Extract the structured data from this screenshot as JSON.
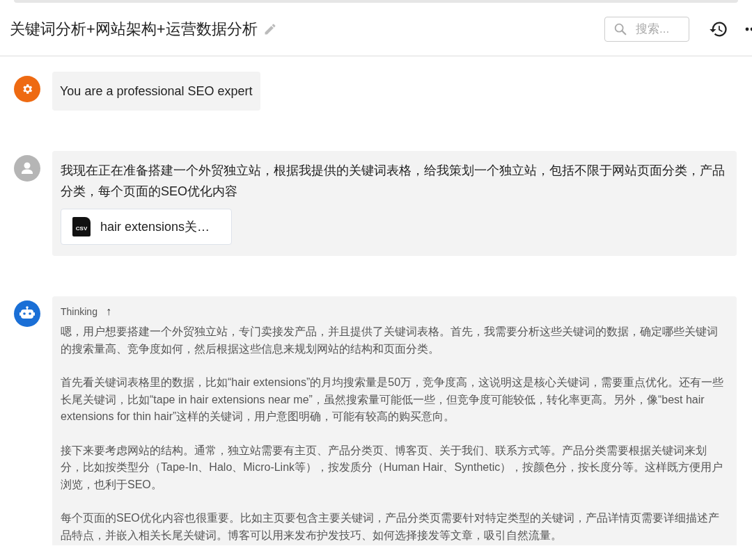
{
  "header": {
    "title": "关键词分析+网站架构+运营数据分析",
    "search": {
      "placeholder": "搜索..."
    }
  },
  "messages": [
    {
      "kind": "system",
      "text": "You are a professional SEO expert"
    },
    {
      "kind": "user",
      "text": "我现在正在准备搭建一个外贸独立站，根据我提供的关键词表格，给我策划一个独立站，包括不限于网站页面分类，产品分类，每个页面的SEO优化内容",
      "attachment": {
        "icon_label": "CSV",
        "name": "hair extensions关…"
      }
    },
    {
      "kind": "assistant",
      "thinking": {
        "label": "Thinking",
        "toggle": "↑",
        "expanded": true,
        "paragraphs": [
          "嗯，用户想要搭建一个外贸独立站，专门卖接发产品，并且提供了关键词表格。首先，我需要分析这些关键词的数据，确定哪些关键词的搜索量高、竞争度如何，然后根据这些信息来规划网站的结构和页面分类。",
          "首先看关键词表格里的数据，比如“hair extensions”的月均搜索量是50万，竞争度高，这说明这是核心关键词，需要重点优化。还有一些长尾关键词，比如“tape in hair extensions near me”，虽然搜索量可能低一些，但竞争度可能较低，转化率更高。另外，像“best hair extensions for thin hair”这样的关键词，用户意图明确，可能有较高的购买意向。",
          "接下来要考虑网站的结构。通常，独立站需要有主页、产品分类页、博客页、关于我们、联系方式等。产品分类需要根据关键词来划分，比如按类型分（Tape-In、Halo、Micro-Link等），按发质分（Human Hair、Synthetic），按颜色分，按长度分等。这样既方便用户浏览，也利于SEO。",
          "每个页面的SEO优化内容也很重要。比如主页要包含主要关键词，产品分类页需要针对特定类型的关键词，产品详情页需要详细描述产品特点，并嵌入相关长尾关键词。博客可以用来发布护发技巧、如何选择接发等文章，吸引自然流量。"
        ]
      }
    }
  ]
}
